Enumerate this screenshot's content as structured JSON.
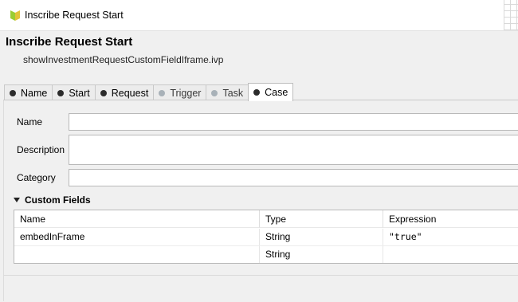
{
  "window": {
    "title": "Inscribe Request Start",
    "icon": "inscribe-icon"
  },
  "header": {
    "title": "Inscribe Request Start",
    "subtitle": "showInvestmentRequestCustomFieldIframe.ivp"
  },
  "tabs": [
    {
      "label": "Name",
      "state": "enabled"
    },
    {
      "label": "Start",
      "state": "enabled"
    },
    {
      "label": "Request",
      "state": "enabled"
    },
    {
      "label": "Trigger",
      "state": "disabled"
    },
    {
      "label": "Task",
      "state": "disabled"
    },
    {
      "label": "Case",
      "state": "active"
    }
  ],
  "form": {
    "name_label": "Name",
    "name_value": "",
    "description_label": "Description",
    "description_value": "",
    "category_label": "Category",
    "category_value": ""
  },
  "custom_fields": {
    "title": "Custom Fields",
    "columns": [
      "Name",
      "Type",
      "Expression"
    ],
    "rows": [
      {
        "name": "embedInFrame",
        "type": "String",
        "expression": "\"true\""
      },
      {
        "name": "",
        "type": "String",
        "expression": ""
      }
    ]
  }
}
